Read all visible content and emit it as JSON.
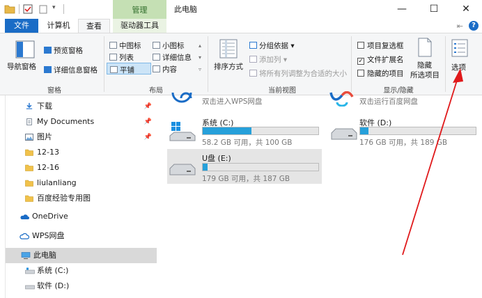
{
  "window": {
    "context_group": "管理",
    "title": "此电脑",
    "minimize": "—",
    "maximize": "☐",
    "close": "✕"
  },
  "tabs": {
    "file": "文件",
    "computer": "计算机",
    "view": "查看",
    "drive_tools": "驱动器工具",
    "pin": "⇤",
    "help": "?"
  },
  "ribbon": {
    "panes": {
      "label": "窗格",
      "nav_pane": "导航窗格",
      "preview_pane": "预览窗格",
      "details_pane": "详细信息窗格"
    },
    "layout": {
      "label": "布局",
      "medium_icons": "中图标",
      "small_icons": "小图标",
      "list": "列表",
      "details": "详细信息",
      "tiles": "平铺",
      "content": "内容"
    },
    "current_view": {
      "label": "当前视图",
      "sort_by": "排序方式",
      "group_by": "分组依据",
      "add_columns": "添加列",
      "size_all_columns": "将所有列调整为合适的大小"
    },
    "show_hide": {
      "label": "显示/隐藏",
      "item_checkboxes": "项目复选框",
      "file_extensions": "文件扩展名",
      "hidden_items": "隐藏的项目",
      "hide_line1": "隐藏",
      "hide_line2": "所选项目"
    },
    "options": "选项"
  },
  "nav": {
    "items": [
      {
        "label": "下载"
      },
      {
        "label": "My Documents"
      },
      {
        "label": "图片"
      },
      {
        "label": "12-13"
      },
      {
        "label": "12-16"
      },
      {
        "label": "liulanliang"
      },
      {
        "label": "百度经验专用图"
      },
      {
        "label": "OneDrive"
      },
      {
        "label": "WPS网盘"
      },
      {
        "label": "此电脑"
      },
      {
        "label": "系统 (C:)"
      },
      {
        "label": "软件 (D:)"
      }
    ],
    "pin_glyph": "📌"
  },
  "content": {
    "wps_drive": "双击进入WPS网盘",
    "baidu_drive": "双击运行百度网盘",
    "drives": [
      {
        "name": "系统 (C:)",
        "info": "58.2 GB 可用，共 100 GB",
        "used_fraction": 0.42
      },
      {
        "name": "软件 (D:)",
        "info": "176 GB 可用，共 189 GB",
        "used_fraction": 0.07
      },
      {
        "name": "U盘 (E:)",
        "info": "179 GB 可用，共 187 GB",
        "used_fraction": 0.04
      }
    ]
  },
  "colors": {
    "accent": "#1a6cc6",
    "context_tab": "#c5e0b4",
    "bar_fill": "#26a0da",
    "annotation_arrow": "#e0191b"
  }
}
